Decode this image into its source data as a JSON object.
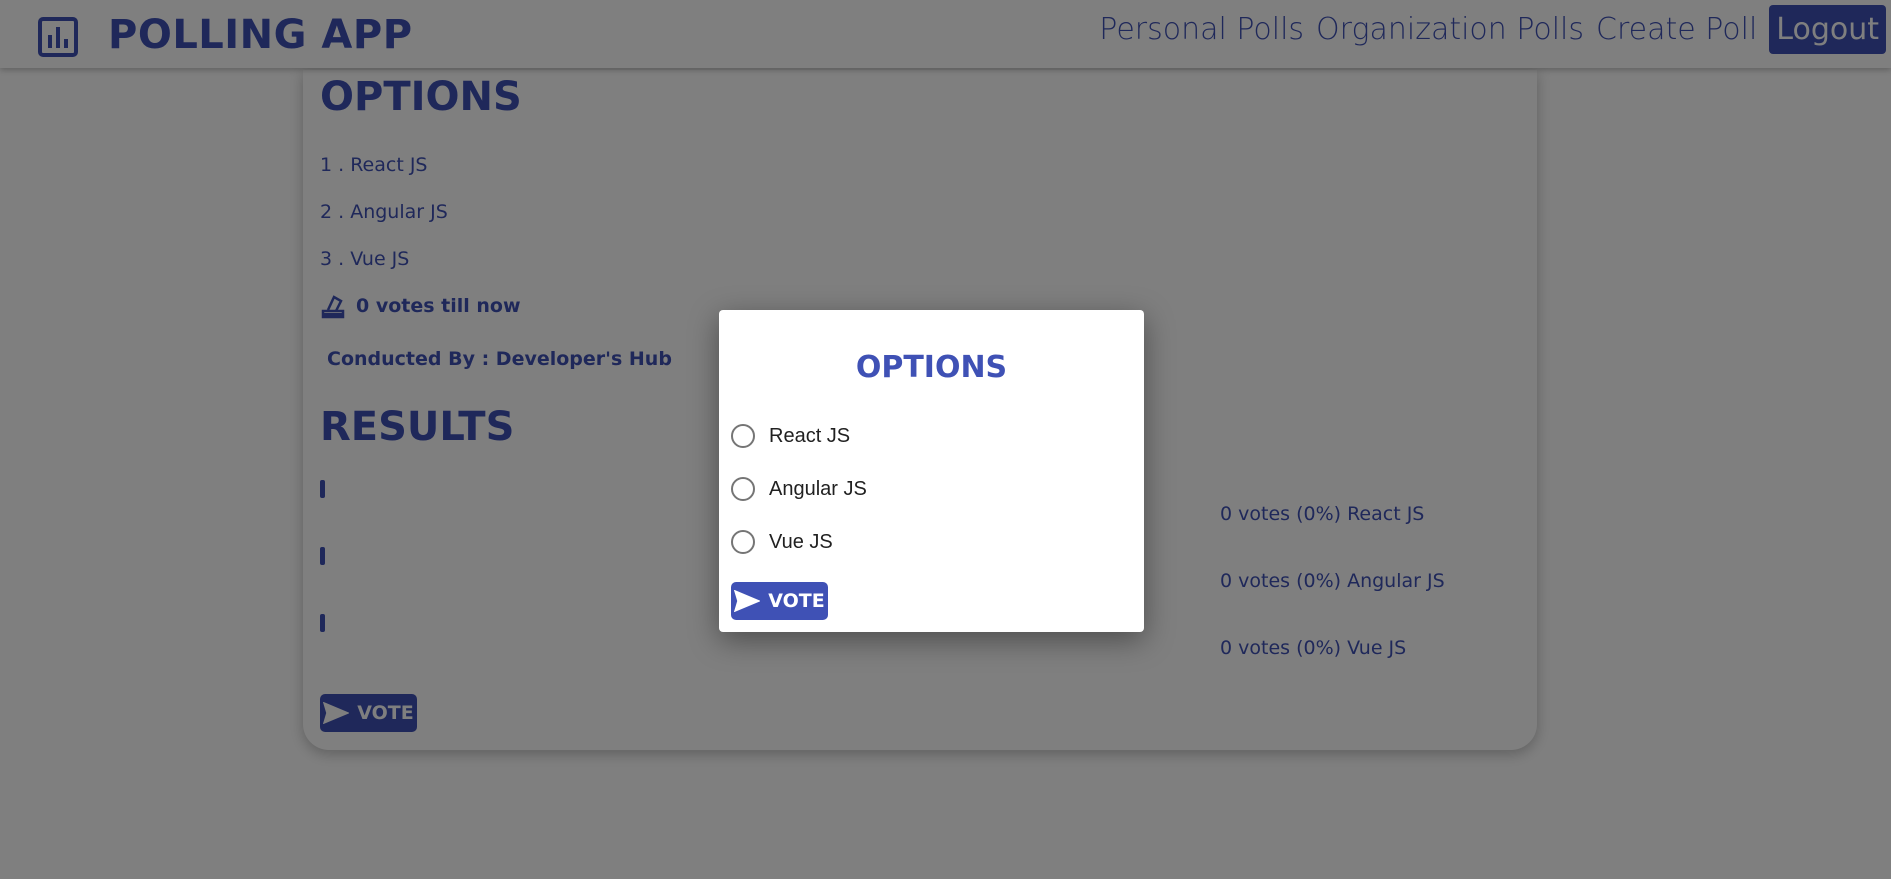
{
  "app": {
    "title": "POLLING APP",
    "logo_icon": "bar-chart-icon"
  },
  "nav": {
    "items": [
      "Personal Polls",
      "Organization Polls",
      "Create Poll"
    ],
    "logout": "Logout"
  },
  "poll": {
    "options_heading": "OPTIONS",
    "options": [
      "1 . React JS",
      "2 . Angular JS",
      "3 . Vue JS"
    ],
    "votes_text": "0 votes till now",
    "votes_icon": "ballot-icon",
    "conducted_by": "Conducted By : Developer's Hub",
    "results_heading": "RESULTS",
    "results": [
      {
        "label": "0 votes (0%) React JS",
        "percent": 0
      },
      {
        "label": "0 votes (0%) Angular JS",
        "percent": 0
      },
      {
        "label": "0 votes (0%) Vue JS",
        "percent": 0
      }
    ],
    "vote_button": "VOTE"
  },
  "modal": {
    "title": "OPTIONS",
    "choices": [
      "React JS",
      "Angular JS",
      "Vue JS"
    ],
    "vote_button": "VOTE",
    "send_icon": "send-icon"
  },
  "colors": {
    "primary": "#3f51b5",
    "overlay": "rgba(0,0,0,0.5)"
  }
}
